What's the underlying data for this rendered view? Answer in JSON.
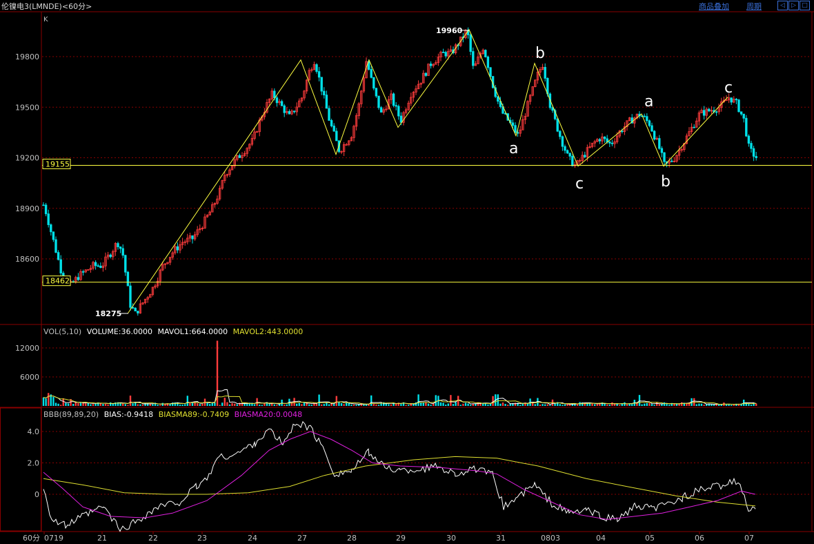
{
  "header": {
    "title": "伦镍电3(LMNDE)<60分>",
    "overlay_label": "商品叠加",
    "period_label": "周期",
    "nav_left": "◁",
    "nav_right": "▷",
    "nav_zoom": "□"
  },
  "main_panel": {
    "tag": "K",
    "y_ticks": [
      "19800",
      "19500",
      "19200",
      "18900",
      "18600"
    ],
    "hlines": [
      {
        "label": "19155",
        "value": 19155
      },
      {
        "label": "18462",
        "value": 18462
      }
    ],
    "high_label": "19960",
    "low_label": "18275",
    "wave_labels": [
      "b",
      "a",
      "c",
      "a",
      "b",
      "c"
    ]
  },
  "vol_panel": {
    "label_prefix": "VOL(5,10)",
    "volume": "VOLUME:36.0000",
    "mavol1": "MAVOL1:664.0000",
    "mavol2": "MAVOL2:443.0000",
    "y_ticks": [
      "12000",
      "6000"
    ]
  },
  "bias_panel": {
    "label_prefix": "BBB(89,89,20)",
    "bias": "BIAS:-0.9418",
    "biasma89": "BIASMA89:-0.7409",
    "biasma20": "BIASMA20:0.0048",
    "y_ticks": [
      "4.0",
      "2.0",
      "0"
    ]
  },
  "x_axis": {
    "period_label": "60分",
    "dates": [
      "0719",
      "21",
      "22",
      "23",
      "24",
      "27",
      "28",
      "29",
      "30",
      "31",
      "0803",
      "04",
      "05",
      "06",
      "07"
    ]
  },
  "colors": {
    "up": "#ff3c3c",
    "down": "#00e0e8",
    "support_line": "#ffff40",
    "wave_line": "#ffff40",
    "biasma89": "#e0e030",
    "biasma20": "#e020e0",
    "bias": "#ffffff",
    "grid": "#8a0000",
    "axis_text": "#c0c0c0"
  },
  "chart_data": {
    "type": "candlestick",
    "title": "伦镍电3(LMNDE)<60分>",
    "period": "60分",
    "x_dates": [
      "0719",
      "21",
      "22",
      "23",
      "24",
      "27",
      "28",
      "29",
      "30",
      "31",
      "0803",
      "04",
      "05",
      "06",
      "07"
    ],
    "price_range": [
      18250,
      20050
    ],
    "support_levels": [
      19155,
      18462
    ],
    "extremes": {
      "high": 19960,
      "low": 18275
    },
    "wave_path": [
      {
        "date": "21",
        "price": 18275
      },
      {
        "date": "27",
        "price": 19780
      },
      {
        "date": "28",
        "price": 19220
      },
      {
        "date": "28",
        "price": 19780
      },
      {
        "date": "29",
        "price": 19380
      },
      {
        "date": "30",
        "price": 19960
      },
      {
        "date": "31",
        "price": 19330,
        "label": "a"
      },
      {
        "date": "31",
        "price": 19760,
        "label": "b"
      },
      {
        "date": "0803",
        "price": 19150,
        "label": "c"
      },
      {
        "date": "04",
        "price": 19460,
        "label": "a"
      },
      {
        "date": "05",
        "price": 19150,
        "label": "b"
      },
      {
        "date": "06",
        "price": 19560,
        "label": "c"
      }
    ],
    "volume": {
      "MAVOL1": 664,
      "MAVOL2": 443,
      "last": 36,
      "y_range": [
        0,
        14000
      ],
      "spike": {
        "date": "23",
        "value": 13500
      }
    },
    "bias": {
      "BIAS": -0.9418,
      "BIASMA89": -0.7409,
      "BIASMA20": 0.0048,
      "y_range": [
        -2.4,
        5.0
      ]
    }
  }
}
